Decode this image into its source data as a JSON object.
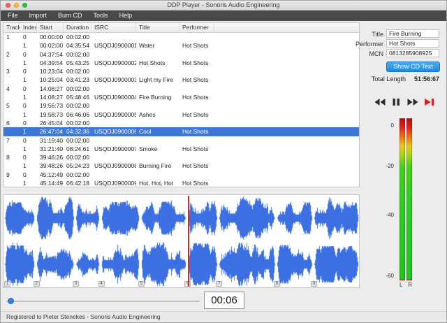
{
  "window": {
    "title": "DDP Player - Sonoris Audio Engineering",
    "status_text": "Registered to Pieter Stenekes - Sonoris Audio Engineering"
  },
  "menu": {
    "items": [
      "File",
      "Import",
      "Burn CD",
      "Tools",
      "Help"
    ]
  },
  "table": {
    "columns": [
      "Track",
      "Index",
      "Start",
      "Duration",
      "ISRC",
      "Title",
      "Performer"
    ],
    "rows": [
      {
        "track": "1",
        "index": "0",
        "start": "00:00:00",
        "duration": "00:02:00",
        "isrc": "",
        "title": "",
        "performer": "",
        "selected": false
      },
      {
        "track": "",
        "index": "1",
        "start": "00:02:00",
        "duration": "04:35:54",
        "isrc": "USQDJ0900001",
        "title": "Water",
        "performer": "Hot Shots",
        "selected": false
      },
      {
        "track": "2",
        "index": "0",
        "start": "04:37:54",
        "duration": "00:02:00",
        "isrc": "",
        "title": "",
        "performer": "",
        "selected": false
      },
      {
        "track": "",
        "index": "1",
        "start": "04:39:54",
        "duration": "05:43:25",
        "isrc": "USQDJ0900002",
        "title": "Hot Shots",
        "performer": "Hot Shots",
        "selected": false
      },
      {
        "track": "3",
        "index": "0",
        "start": "10:23:04",
        "duration": "00:02:00",
        "isrc": "",
        "title": "",
        "performer": "",
        "selected": false
      },
      {
        "track": "",
        "index": "1",
        "start": "10:25:04",
        "duration": "03:41:23",
        "isrc": "USQDJ0900003",
        "title": "Light my Fire",
        "performer": "Hot Shots",
        "selected": false
      },
      {
        "track": "4",
        "index": "0",
        "start": "14:06:27",
        "duration": "00:02:00",
        "isrc": "",
        "title": "",
        "performer": "",
        "selected": false
      },
      {
        "track": "",
        "index": "1",
        "start": "14:08:27",
        "duration": "05:48:46",
        "isrc": "USQDJ0900004",
        "title": "Fire Burning",
        "performer": "Hot Shots",
        "selected": false
      },
      {
        "track": "5",
        "index": "0",
        "start": "19:56:73",
        "duration": "00:02:00",
        "isrc": "",
        "title": "",
        "performer": "",
        "selected": false
      },
      {
        "track": "",
        "index": "1",
        "start": "19:58:73",
        "duration": "06:46:06",
        "isrc": "USQDJ0900005",
        "title": "Ashes",
        "performer": "Hot Shots",
        "selected": false
      },
      {
        "track": "6",
        "index": "0",
        "start": "26:45:04",
        "duration": "00:02:00",
        "isrc": "",
        "title": "",
        "performer": "",
        "selected": false
      },
      {
        "track": "",
        "index": "1",
        "start": "26:47:04",
        "duration": "04:32:36",
        "isrc": "USQDJ0900006",
        "title": "Cool",
        "performer": "Hot Shots",
        "selected": true
      },
      {
        "track": "7",
        "index": "0",
        "start": "31:19:40",
        "duration": "00:02:00",
        "isrc": "",
        "title": "",
        "performer": "",
        "selected": false
      },
      {
        "track": "",
        "index": "1",
        "start": "31:21:40",
        "duration": "08:24:61",
        "isrc": "USQDJ0900007",
        "title": "Smoke",
        "performer": "Hot Shots",
        "selected": false
      },
      {
        "track": "8",
        "index": "0",
        "start": "39:46:26",
        "duration": "00:02:00",
        "isrc": "",
        "title": "",
        "performer": "",
        "selected": false
      },
      {
        "track": "",
        "index": "1",
        "start": "39:48:26",
        "duration": "05:24:23",
        "isrc": "USQDJ0900008",
        "title": "Burning Fire",
        "performer": "Hot Shots",
        "selected": false
      },
      {
        "track": "9",
        "index": "0",
        "start": "45:12:49",
        "duration": "00:02:00",
        "isrc": "",
        "title": "",
        "performer": "",
        "selected": false
      },
      {
        "track": "",
        "index": "1",
        "start": "45:14:49",
        "duration": "06:42:18",
        "isrc": "USQDJ0900009",
        "title": "Hot, Hot, Hot",
        "performer": "Hot Shots",
        "selected": false
      }
    ]
  },
  "cdtext": {
    "title_label": "Title",
    "title": "Fire Burning",
    "performer_label": "Performer",
    "performer": "Hot Shots",
    "mcn_label": "MCN",
    "mcn": "0813285908925",
    "show_button": "Show CD Text",
    "total_length_label": "Total Length",
    "total_length": "51:56:67"
  },
  "transport": {
    "buttons": [
      "rewind",
      "pause",
      "fast-forward",
      "skip-end"
    ]
  },
  "meter": {
    "scale_labels": [
      "0",
      "-20",
      "-40",
      "-60"
    ],
    "channel_labels": [
      "L",
      "R"
    ]
  },
  "playback": {
    "time_display": "00:06"
  },
  "colors": {
    "selection_blue": "#3d78d8",
    "waveform_blue": "#3c70e2",
    "playhead_red": "#c42b2b",
    "button_blue": "#1f8ae2",
    "meter_red": "#e01f1f",
    "meter_yellow": "#ecc714",
    "meter_green": "#25cd25",
    "traffic_red": "#ff5f57",
    "traffic_yellow": "#febc2e",
    "traffic_green": "#29c73f"
  }
}
